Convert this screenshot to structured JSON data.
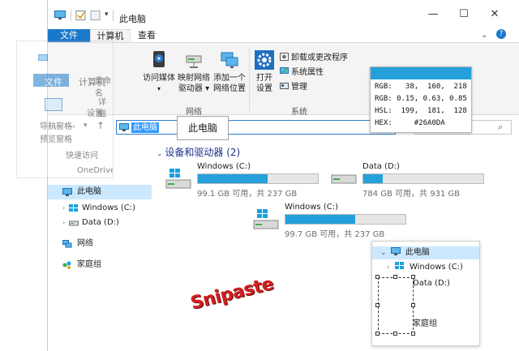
{
  "window": {
    "title": "此电脑"
  },
  "ribbon_tabs": {
    "file": "文件",
    "computer": "计算机",
    "view": "查看"
  },
  "ribbon": {
    "access_media": "访问媒体",
    "map_drive_1": "映射网络",
    "map_drive_2": "驱动器",
    "add_location_1": "添加一个",
    "add_location_2": "网络位置",
    "open_settings_1": "打开",
    "open_settings_2": "设置",
    "uninstall": "卸载或更改程序",
    "system_props": "系统属性",
    "manage": "管理",
    "group_network": "网络",
    "group_system": "系统",
    "rename": "重命名"
  },
  "address": {
    "path": "此电脑"
  },
  "tooltip": "此电脑",
  "color_picker": {
    "rgb": "RGB:   38,  160,  218",
    "rgbf": "RGB: 0.15, 0.63, 0.85",
    "hsl": "HSL:  199,  181,  128",
    "hex": "HEX:     #26A0DA",
    "swatch_color": "#26A0DA"
  },
  "nav": {
    "this_pc": "此电脑",
    "windows_c": "Windows (C:)",
    "data_d": "Data (D:)",
    "network": "网络",
    "homegroup": "家庭组"
  },
  "content": {
    "section_title": "设备和驱动器 (2)",
    "drives": [
      {
        "name": "Windows (C:)",
        "size": "99.1 GB 可用，共 237 GB",
        "used": 0.58
      },
      {
        "name": "Data (D:)",
        "size": "784 GB 可用，共 931 GB",
        "used": 0.16
      },
      {
        "name": "Windows (C:)",
        "size": "99.7 GB 可用，共 237 GB",
        "used": 0.58
      }
    ]
  },
  "ghost": {
    "file": "文件",
    "computer": "计算机",
    "rename": "重命名",
    "details": "详细",
    "nav_pane": "导航窗格",
    "preview_pane": "预览窗格",
    "quick_access": "快速访问",
    "onedrive": "OneDrive",
    "settings": "设置"
  },
  "logo": "Snipaste",
  "snip_tree": {
    "this_pc": "此电脑",
    "windows_c": "Windows (C:)",
    "data_d": "Data (D:)",
    "homegroup": "家庭组"
  },
  "colors": {
    "accent": "#26A0DA",
    "file_tab": "#1979CA",
    "logo": "#D11F1F"
  }
}
